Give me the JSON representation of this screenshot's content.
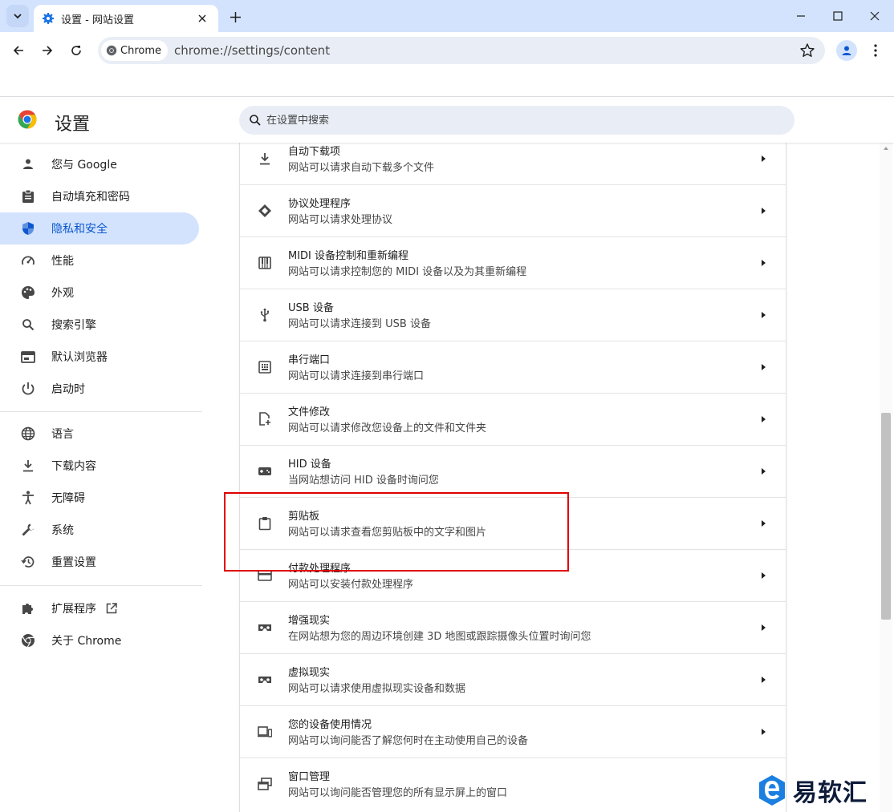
{
  "window": {
    "tab_title": "设置 - 网站设置"
  },
  "toolbar": {
    "chip_label": "Chrome",
    "url": "chrome://settings/content"
  },
  "header": {
    "title": "设置",
    "search_placeholder": "在设置中搜索"
  },
  "sidebar": {
    "items": [
      {
        "label": "您与 Google",
        "icon": "person-icon"
      },
      {
        "label": "自动填充和密码",
        "icon": "clipboard-icon"
      },
      {
        "label": "隐私和安全",
        "icon": "shield-icon",
        "active": true
      },
      {
        "label": "性能",
        "icon": "speedometer-icon"
      },
      {
        "label": "外观",
        "icon": "palette-icon"
      },
      {
        "label": "搜索引擎",
        "icon": "search-icon"
      },
      {
        "label": "默认浏览器",
        "icon": "browser-icon"
      },
      {
        "label": "启动时",
        "icon": "power-icon"
      },
      {
        "label": "语言",
        "icon": "globe-icon"
      },
      {
        "label": "下载内容",
        "icon": "download-icon"
      },
      {
        "label": "无障碍",
        "icon": "accessibility-icon"
      },
      {
        "label": "系统",
        "icon": "wrench-icon"
      },
      {
        "label": "重置设置",
        "icon": "restore-icon"
      },
      {
        "label": "扩展程序",
        "icon": "puzzle-icon"
      },
      {
        "label": "关于 Chrome",
        "icon": "chrome-icon"
      }
    ]
  },
  "content": {
    "rows": [
      {
        "title": "自动下载项",
        "desc": "网站可以请求自动下载多个文件",
        "icon": "download-icon"
      },
      {
        "title": "协议处理程序",
        "desc": "网站可以请求处理协议",
        "icon": "protocol-icon"
      },
      {
        "title": "MIDI 设备控制和重新编程",
        "desc": "网站可以请求控制您的 MIDI 设备以及为其重新编程",
        "icon": "piano-icon"
      },
      {
        "title": "USB 设备",
        "desc": "网站可以请求连接到 USB 设备",
        "icon": "usb-icon"
      },
      {
        "title": "串行端口",
        "desc": "网站可以请求连接到串行端口",
        "icon": "serial-port-icon"
      },
      {
        "title": "文件修改",
        "desc": "网站可以请求修改您设备上的文件和文件夹",
        "icon": "file-edit-icon"
      },
      {
        "title": "HID 设备",
        "desc": "当网站想访问 HID 设备时询问您",
        "icon": "gamepad-icon"
      },
      {
        "title": "剪贴板",
        "desc": "网站可以请求查看您剪贴板中的文字和图片",
        "icon": "clipboard-icon"
      },
      {
        "title": "付款处理程序",
        "desc": "网站可以安装付款处理程序",
        "icon": "payment-card-icon"
      },
      {
        "title": "增强现实",
        "desc": "在网站想为您的周边环境创建 3D 地图或跟踪摄像头位置时询问您",
        "icon": "ar-headset-icon"
      },
      {
        "title": "虚拟现实",
        "desc": "网站可以请求使用虚拟现实设备和数据",
        "icon": "vr-headset-icon"
      },
      {
        "title": "您的设备使用情况",
        "desc": "网站可以询问能否了解您何时在主动使用自己的设备",
        "icon": "device-usage-icon"
      },
      {
        "title": "窗口管理",
        "desc": "网站可以询问能否管理您的所有显示屏上的窗口",
        "icon": "window-management-icon"
      }
    ]
  },
  "watermark": {
    "text": "易软汇"
  },
  "colors": {
    "accent": "#0b57d0",
    "active_bg": "#d3e3fd",
    "highlight": "#e00000"
  }
}
